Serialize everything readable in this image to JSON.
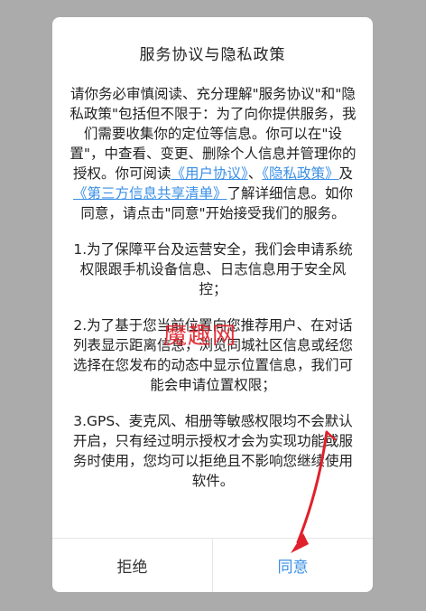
{
  "dialog": {
    "title": "服务协议与隐私政策",
    "intro": {
      "text_1": "请你务必审慎阅读、充分理解\"服务协议\"和\"隐私政策\"包括但不限于：为了向你提供服务，我们需要收集你的定位等信息。你可以在\"设置\"，中查看、变更、删除个人信息并管理你的授权。你可阅读",
      "link_user_agreement": "《用户协议》",
      "sep_1": "、",
      "link_privacy_policy": "《隐私政策》",
      "sep_2": "及",
      "link_third_party": "《第三方信息共享清单》",
      "text_2": "了解详细信息。如你同意，请点击\"同意\"开始接受我们的服务。"
    },
    "items": [
      "1.为了保障平台及运营安全，我们会申请系统权限跟手机设备信息、日志信息用于安全风控；",
      "2.为了基于您当前位置向您推荐用户、在对话列表显示距离信息，浏览同城社区信息或经您选择在您发布的动态中显示位置信息，我们可能会申请位置权限；",
      "3.GPS、麦克风、相册等敏感权限均不会默认开启，只有经过明示授权才会为实现功能或服务时使用，您均可以拒绝且不影响您继续使用软件。"
    ],
    "buttons": {
      "reject": "拒绝",
      "agree": "同意"
    }
  },
  "watermark": {
    "text": "魔趣网",
    "color": "#e0202a"
  },
  "colors": {
    "link": "#3a8fe6",
    "overlay": "#ababab",
    "arrow": "#e0202a"
  }
}
